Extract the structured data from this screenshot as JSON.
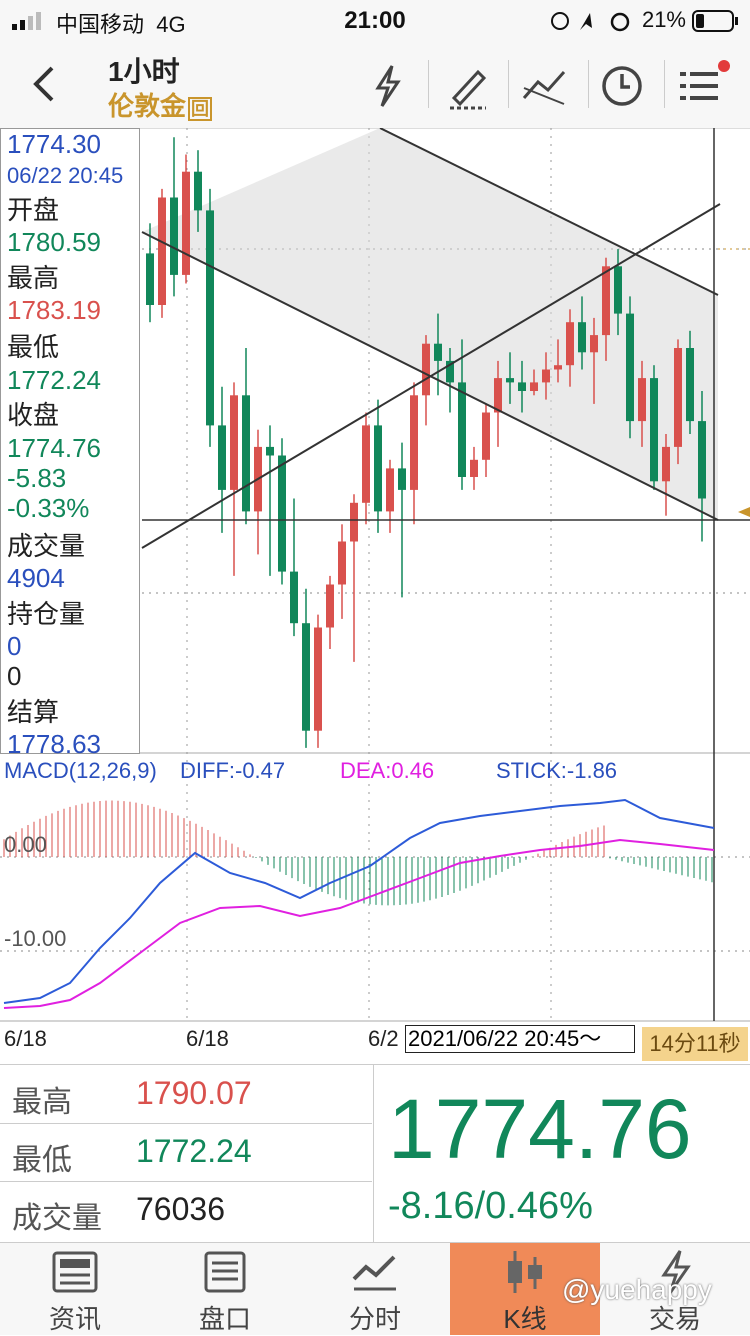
{
  "status": {
    "carrier": "中国移动",
    "network": "4G",
    "time": "21:00",
    "battery": "21%"
  },
  "header": {
    "title": "1小时",
    "subtitle": "伦敦金",
    "subtitle_badge": "回"
  },
  "info": {
    "price": "1774.30",
    "datetime": "06/22 20:45",
    "open_label": "开盘",
    "open": "1780.59",
    "high_label": "最高",
    "high": "1783.19",
    "low_label": "最低",
    "low": "1772.24",
    "close_label": "收盘",
    "close": "1774.76",
    "change": "-5.83",
    "change_pct": "-0.33%",
    "volume_label": "成交量",
    "volume": "4904",
    "oi_label": "持仓量",
    "oi": "0",
    "oi_extra": "0",
    "settle_label": "结算",
    "settle": "1778.63"
  },
  "macd": {
    "name": "MACD(12,26,9)",
    "diff": "DIFF:-0.47",
    "dea": "DEA:0.46",
    "stick": "STICK:-1.86",
    "level0": "0.00",
    "level1": "-10.00"
  },
  "axis": {
    "d1": "6/18",
    "d2": "6/18",
    "d3": "6/2",
    "cursor_time": "2021/06/22 20:45～",
    "countdown": "14分11秒"
  },
  "stats": {
    "high_label": "最高",
    "high": "1790.07",
    "low_label": "最低",
    "low": "1772.24",
    "vol_label": "成交量",
    "vol": "76036",
    "last": "1774.76",
    "change": "-8.16/0.46%"
  },
  "nav": [
    {
      "label": "资讯"
    },
    {
      "label": "盘口"
    },
    {
      "label": "分时"
    },
    {
      "label": "K线"
    },
    {
      "label": "交易"
    }
  ],
  "watermark": "@yuehappy",
  "colors": {
    "up": "#d9514d",
    "down": "#11875a",
    "accent": "#f08a58",
    "gold": "#c9952c"
  },
  "chart_data": {
    "type": "candlestick",
    "price_axis_marks": [
      "1774.30"
    ],
    "candles": [
      [
        1780.5,
        1781.2,
        1778.9,
        1779.3
      ],
      [
        1779.3,
        1782.0,
        1779.0,
        1781.8
      ],
      [
        1781.8,
        1783.2,
        1779.5,
        1780.0
      ],
      [
        1780.0,
        1782.8,
        1779.8,
        1782.4
      ],
      [
        1782.4,
        1782.9,
        1781.0,
        1781.5
      ],
      [
        1781.5,
        1782.0,
        1776.0,
        1776.5
      ],
      [
        1776.5,
        1777.4,
        1774.0,
        1775.0
      ],
      [
        1775.0,
        1777.5,
        1773.0,
        1777.2
      ],
      [
        1777.2,
        1778.3,
        1774.2,
        1774.5
      ],
      [
        1774.5,
        1776.4,
        1773.5,
        1776.0
      ],
      [
        1776.0,
        1776.5,
        1773.0,
        1775.8
      ],
      [
        1775.8,
        1776.2,
        1772.8,
        1773.1
      ],
      [
        1773.1,
        1774.8,
        1771.6,
        1771.9
      ],
      [
        1771.9,
        1772.7,
        1769.0,
        1769.4
      ],
      [
        1769.4,
        1772.1,
        1769.0,
        1771.8
      ],
      [
        1771.8,
        1773.0,
        1771.3,
        1772.8
      ],
      [
        1772.8,
        1774.2,
        1772.0,
        1773.8
      ],
      [
        1773.8,
        1774.9,
        1771.0,
        1774.7
      ],
      [
        1774.7,
        1776.8,
        1774.2,
        1776.5
      ],
      [
        1776.5,
        1777.1,
        1774.0,
        1774.5
      ],
      [
        1774.5,
        1775.7,
        1774.0,
        1775.5
      ],
      [
        1775.5,
        1776.1,
        1772.5,
        1775.0
      ],
      [
        1775.0,
        1777.5,
        1774.2,
        1777.2
      ],
      [
        1777.2,
        1778.6,
        1776.5,
        1778.4
      ],
      [
        1778.4,
        1779.1,
        1777.2,
        1778.0
      ],
      [
        1778.0,
        1778.3,
        1776.8,
        1777.5
      ],
      [
        1777.5,
        1778.5,
        1775.0,
        1775.3
      ],
      [
        1775.3,
        1776.0,
        1775.0,
        1775.7
      ],
      [
        1775.7,
        1777.0,
        1775.3,
        1776.8
      ],
      [
        1776.8,
        1778.0,
        1776.0,
        1777.6
      ],
      [
        1777.6,
        1778.2,
        1777.0,
        1777.5
      ],
      [
        1777.5,
        1778.0,
        1776.8,
        1777.3
      ],
      [
        1777.3,
        1777.8,
        1777.2,
        1777.5
      ],
      [
        1777.5,
        1778.2,
        1777.1,
        1777.8
      ],
      [
        1777.8,
        1778.5,
        1777.5,
        1777.9
      ],
      [
        1777.9,
        1779.2,
        1777.4,
        1778.9
      ],
      [
        1778.9,
        1779.5,
        1777.8,
        1778.2
      ],
      [
        1778.2,
        1779.0,
        1777.0,
        1778.6
      ],
      [
        1778.6,
        1780.4,
        1778.0,
        1780.2
      ],
      [
        1780.2,
        1780.6,
        1778.6,
        1779.1
      ],
      [
        1779.1,
        1779.5,
        1776.2,
        1776.6
      ],
      [
        1776.6,
        1778.0,
        1776.0,
        1777.6
      ],
      [
        1777.6,
        1777.9,
        1775.0,
        1775.2
      ],
      [
        1775.2,
        1776.3,
        1774.4,
        1776.0
      ],
      [
        1776.0,
        1778.5,
        1775.6,
        1778.3
      ],
      [
        1778.3,
        1778.7,
        1776.3,
        1776.6
      ],
      [
        1776.6,
        1777.3,
        1773.8,
        1774.8
      ]
    ]
  }
}
